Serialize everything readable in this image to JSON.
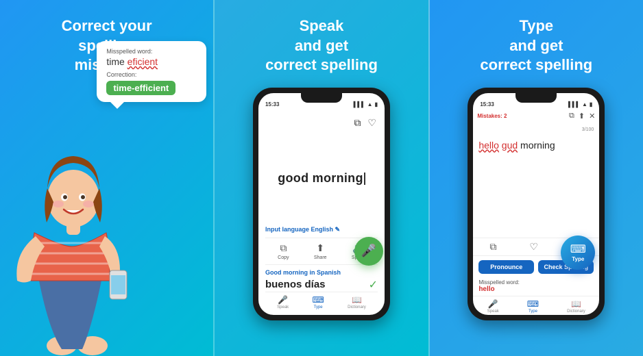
{
  "panel1": {
    "heading_line1": "Correct your",
    "heading_line2": "spelling",
    "heading_line3": "mistakes",
    "bubble": {
      "misspelled_label": "Misspelled word:",
      "misspelled_text_correct": "time ",
      "misspelled_text_wrong": "eficient",
      "correction_label": "Correction:",
      "correction_text": "time-efficient"
    }
  },
  "panel2": {
    "heading_line1": "Speak",
    "heading_line2": "and get",
    "heading_line3": "correct spelling",
    "phone": {
      "time": "15:33",
      "input_language_label": "Input language",
      "input_language_value": "English",
      "main_text": "good morning",
      "copy_label": "Copy",
      "share_label": "Share",
      "speak_label": "Speak",
      "translation_label": "Good morning in Spanish",
      "translated_text": "buenos días",
      "nav_speak": "Speak",
      "nav_type": "Type",
      "nav_dictionary": "Dictionary"
    }
  },
  "panel3": {
    "heading_line1": "Type",
    "heading_line2": "and get",
    "heading_line3": "correct spelling",
    "phone": {
      "time": "15:33",
      "mistakes_label": "Mistakes: 2",
      "char_count": "3/100",
      "text_normal_before": "",
      "text_error1": "hello",
      "text_error2": "gud",
      "text_normal_after": " morning",
      "misspelled_label": "Misspelled word:",
      "misspelled_word": "hello",
      "btn_pronounce": "Pronounce",
      "btn_check": "Check Spelling",
      "type_label": "Type",
      "nav_speak": "Speak",
      "nav_type": "Type",
      "nav_dictionary": "Dictionary"
    }
  }
}
